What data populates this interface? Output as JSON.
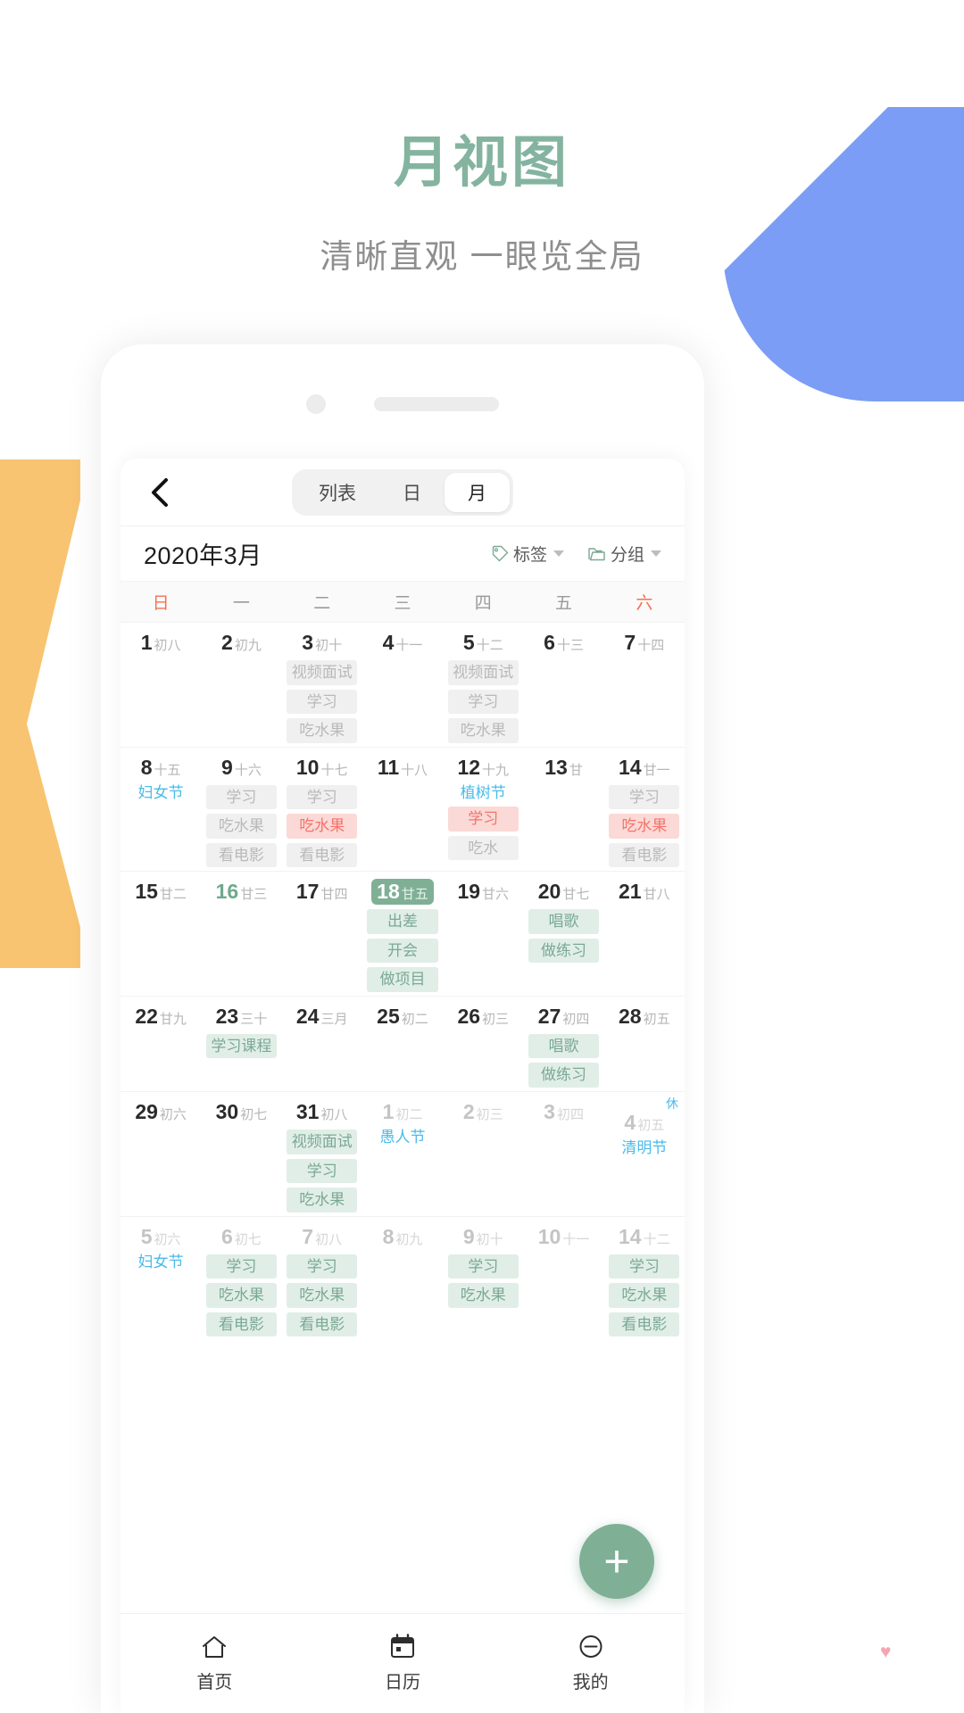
{
  "headline": {
    "title": "月视图",
    "subtitle": "清晰直观 一眼览全局"
  },
  "colors": {
    "brand_green": "#84b49f",
    "accent_blue": "#7b9df5",
    "accent_orange": "#f8c471",
    "festival_blue": "#49bbe8",
    "weekend_red": "#f5714f",
    "event_green": "#7aa993",
    "event_pink": "#f4736a",
    "event_gray": "#b9b9b9"
  },
  "navbar": {
    "back_icon": "chevron-left-icon",
    "segments": [
      {
        "label": "列表",
        "active": false
      },
      {
        "label": "日",
        "active": false
      },
      {
        "label": "月",
        "active": true
      }
    ]
  },
  "month_header": {
    "title": "2020年3月",
    "tag_button": {
      "label": "标签",
      "icon": "tag-icon"
    },
    "group_button": {
      "label": "分组",
      "icon": "folder-icon"
    }
  },
  "weekdays": [
    {
      "label": "日",
      "weekend": true
    },
    {
      "label": "一",
      "weekend": false
    },
    {
      "label": "二",
      "weekend": false
    },
    {
      "label": "三",
      "weekend": false
    },
    {
      "label": "四",
      "weekend": false
    },
    {
      "label": "五",
      "weekend": false
    },
    {
      "label": "六",
      "weekend": true
    }
  ],
  "weeks": [
    [
      {
        "day": "1",
        "lunar": "初八",
        "dim": false,
        "events": []
      },
      {
        "day": "2",
        "lunar": "初九",
        "dim": false,
        "events": []
      },
      {
        "day": "3",
        "lunar": "初十",
        "dim": false,
        "events": [
          {
            "text": "视频面试",
            "style": "gray"
          },
          {
            "text": "学习",
            "style": "gray"
          },
          {
            "text": "吃水果",
            "style": "gray"
          }
        ]
      },
      {
        "day": "4",
        "lunar": "十一",
        "dim": false,
        "events": []
      },
      {
        "day": "5",
        "lunar": "十二",
        "dim": false,
        "events": [
          {
            "text": "视频面试",
            "style": "gray"
          },
          {
            "text": "学习",
            "style": "gray"
          },
          {
            "text": "吃水果",
            "style": "gray"
          }
        ]
      },
      {
        "day": "6",
        "lunar": "十三",
        "dim": false,
        "events": []
      },
      {
        "day": "7",
        "lunar": "十四",
        "dim": false,
        "events": []
      }
    ],
    [
      {
        "day": "8",
        "lunar": "十五",
        "dim": false,
        "festival": "妇女节",
        "events": []
      },
      {
        "day": "9",
        "lunar": "十六",
        "dim": false,
        "events": [
          {
            "text": "学习",
            "style": "gray"
          },
          {
            "text": "吃水果",
            "style": "gray"
          },
          {
            "text": "看电影",
            "style": "gray"
          }
        ]
      },
      {
        "day": "10",
        "lunar": "十七",
        "dim": false,
        "events": [
          {
            "text": "学习",
            "style": "gray"
          },
          {
            "text": "吃水果",
            "style": "pink"
          },
          {
            "text": "看电影",
            "style": "gray"
          }
        ]
      },
      {
        "day": "11",
        "lunar": "十八",
        "dim": false,
        "events": []
      },
      {
        "day": "12",
        "lunar": "十九",
        "dim": false,
        "festival": "植树节",
        "events": [
          {
            "text": "学习",
            "style": "pink"
          },
          {
            "text": "吃水",
            "style": "gray"
          }
        ]
      },
      {
        "day": "13",
        "lunar": "甘",
        "dim": false,
        "events": []
      },
      {
        "day": "14",
        "lunar": "甘一",
        "dim": false,
        "events": [
          {
            "text": "学习",
            "style": "gray"
          },
          {
            "text": "吃水果",
            "style": "pink"
          },
          {
            "text": "看电影",
            "style": "gray"
          }
        ]
      }
    ],
    [
      {
        "day": "15",
        "lunar": "甘二",
        "dim": false,
        "events": []
      },
      {
        "day": "16",
        "lunar": "甘三",
        "dim": false,
        "today": true,
        "events": []
      },
      {
        "day": "17",
        "lunar": "甘四",
        "dim": false,
        "events": []
      },
      {
        "day": "18",
        "lunar": "甘五",
        "dim": false,
        "selected": true,
        "events": [
          {
            "text": "出差",
            "style": "green"
          },
          {
            "text": "开会",
            "style": "green"
          },
          {
            "text": "做项目",
            "style": "green"
          }
        ]
      },
      {
        "day": "19",
        "lunar": "甘六",
        "dim": false,
        "events": []
      },
      {
        "day": "20",
        "lunar": "甘七",
        "dim": false,
        "events": [
          {
            "text": "唱歌",
            "style": "green"
          },
          {
            "text": "做练习",
            "style": "green"
          }
        ]
      },
      {
        "day": "21",
        "lunar": "甘八",
        "dim": false,
        "events": []
      }
    ],
    [
      {
        "day": "22",
        "lunar": "甘九",
        "dim": false,
        "events": []
      },
      {
        "day": "23",
        "lunar": "三十",
        "dim": false,
        "events": [
          {
            "text": "学习课程",
            "style": "green"
          }
        ]
      },
      {
        "day": "24",
        "lunar": "三月",
        "dim": false,
        "events": []
      },
      {
        "day": "25",
        "lunar": "初二",
        "dim": false,
        "events": []
      },
      {
        "day": "26",
        "lunar": "初三",
        "dim": false,
        "events": []
      },
      {
        "day": "27",
        "lunar": "初四",
        "dim": false,
        "events": [
          {
            "text": "唱歌",
            "style": "green"
          },
          {
            "text": "做练习",
            "style": "green"
          }
        ]
      },
      {
        "day": "28",
        "lunar": "初五",
        "dim": false,
        "events": []
      }
    ],
    [
      {
        "day": "29",
        "lunar": "初六",
        "dim": false,
        "events": []
      },
      {
        "day": "30",
        "lunar": "初七",
        "dim": false,
        "events": []
      },
      {
        "day": "31",
        "lunar": "初八",
        "dim": false,
        "events": [
          {
            "text": "视频面试",
            "style": "green"
          },
          {
            "text": "学习",
            "style": "green"
          },
          {
            "text": "吃水果",
            "style": "green"
          }
        ]
      },
      {
        "day": "1",
        "lunar": "初二",
        "dim": true,
        "festival": "愚人节",
        "events": []
      },
      {
        "day": "2",
        "lunar": "初三",
        "dim": true,
        "events": []
      },
      {
        "day": "3",
        "lunar": "初四",
        "dim": true,
        "events": []
      },
      {
        "day": "4",
        "lunar": "初五",
        "dim": true,
        "rest": "休",
        "festival": "清明节",
        "events": []
      }
    ],
    [
      {
        "day": "5",
        "lunar": "初六",
        "dim": true,
        "festival": "妇女节",
        "events": []
      },
      {
        "day": "6",
        "lunar": "初七",
        "dim": true,
        "events": [
          {
            "text": "学习",
            "style": "green"
          },
          {
            "text": "吃水果",
            "style": "green"
          },
          {
            "text": "看电影",
            "style": "green"
          }
        ]
      },
      {
        "day": "7",
        "lunar": "初八",
        "dim": true,
        "events": [
          {
            "text": "学习",
            "style": "green"
          },
          {
            "text": "吃水果",
            "style": "green"
          },
          {
            "text": "看电影",
            "style": "green"
          }
        ]
      },
      {
        "day": "8",
        "lunar": "初九",
        "dim": true,
        "events": []
      },
      {
        "day": "9",
        "lunar": "初十",
        "dim": true,
        "events": [
          {
            "text": "学习",
            "style": "green"
          },
          {
            "text": "吃水果",
            "style": "green"
          }
        ]
      },
      {
        "day": "10",
        "lunar": "十一",
        "dim": true,
        "events": []
      },
      {
        "day": "14",
        "lunar": "十二",
        "dim": true,
        "events": [
          {
            "text": "学习",
            "style": "green"
          },
          {
            "text": "吃水果",
            "style": "green"
          },
          {
            "text": "看电影",
            "style": "green"
          }
        ]
      }
    ]
  ],
  "fab": {
    "label": "+",
    "icon": "plus-icon"
  },
  "tabbar": [
    {
      "label": "首页",
      "icon": "home-icon",
      "active": false
    },
    {
      "label": "日历",
      "icon": "calendar-icon",
      "active": false
    },
    {
      "label": "我的",
      "icon": "profile-icon",
      "active": false
    }
  ]
}
